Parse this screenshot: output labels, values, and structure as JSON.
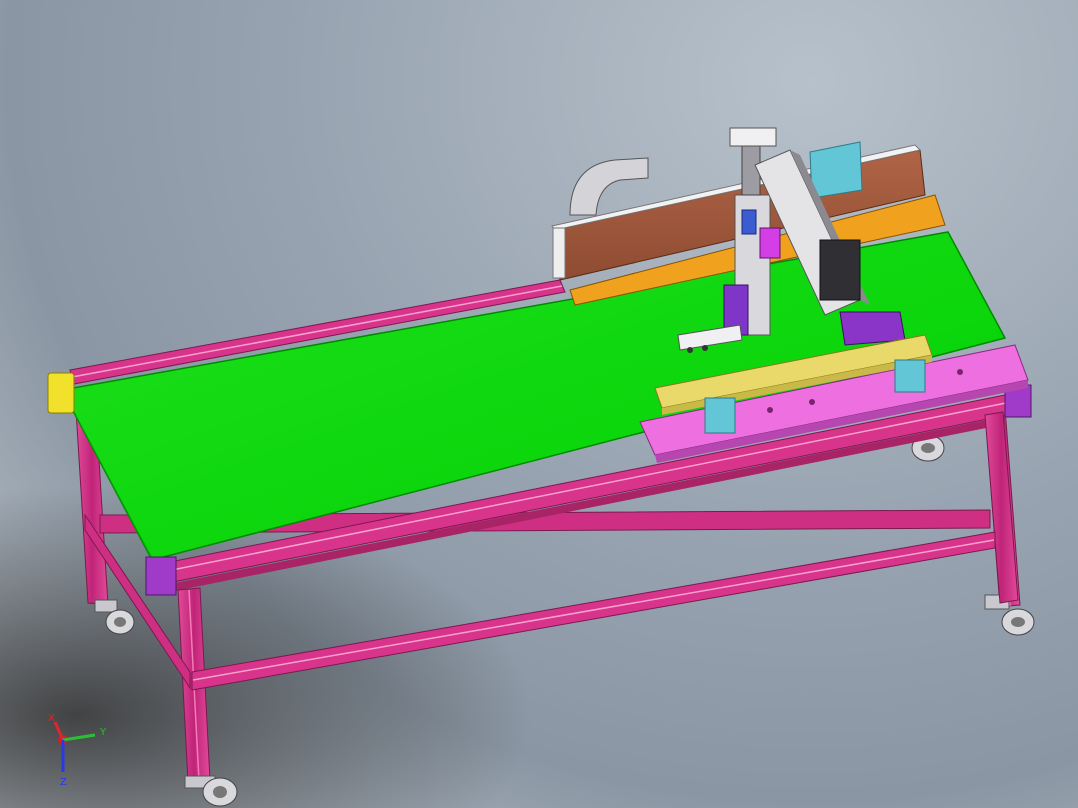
{
  "viewport": {
    "background_top": "#8e9aa7",
    "background_bottom": "#c6cdd4"
  },
  "colors": {
    "frame_magenta": "#d8348c",
    "frame_dark": "#8f1f5c",
    "belt_green": "#00d800",
    "belt_edge": "#009900",
    "plate_pink": "#ee6fe0",
    "plate_pink_dark": "#b747b0",
    "rail_yellow": "#e8d96a",
    "beam_brown": "#a55a3a",
    "beam_orange": "#f0a21e",
    "end_cap_yellow": "#f2e12a",
    "teal_block": "#63c6d6",
    "purple_block": "#8c36c8",
    "steel_light": "#e8e8ea",
    "steel_dark": "#6a6a6e"
  },
  "triad": {
    "x_label": "X",
    "y_label": "Y",
    "z_label": "Z",
    "x_color": "#e0262b",
    "y_color": "#2bbf34",
    "z_color": "#2a39e6"
  }
}
